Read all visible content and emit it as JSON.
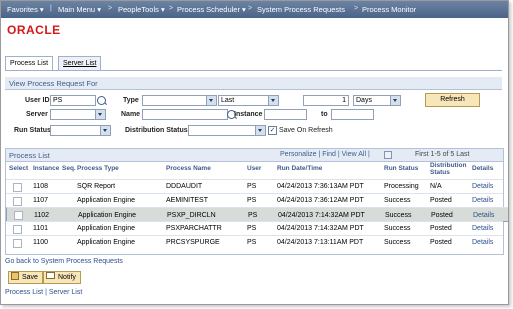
{
  "topnav": {
    "items": [
      {
        "label": "Favorites"
      },
      {
        "label": "Main Menu"
      },
      {
        "label": "PeopleTools"
      },
      {
        "label": "Process Scheduler"
      },
      {
        "label": "System Process Requests"
      },
      {
        "label": "Process Monitor"
      }
    ]
  },
  "logo": "ORACLE",
  "tabs": [
    {
      "label": "Process List",
      "active": true
    },
    {
      "label": "Server List",
      "active": false
    }
  ],
  "filters": {
    "section_title": "View Process Request For",
    "user_id_label": "User ID",
    "user_id_value": "PS",
    "type_label": "Type",
    "type_value": "",
    "last_value": "Last",
    "last_count": "1",
    "days_value": "Days",
    "refresh_label": "Refresh",
    "server_label": "Server",
    "server_value": "",
    "name_label": "Name",
    "name_value": "",
    "instance_label": "Instance",
    "instance_from": "",
    "to_label": "to",
    "instance_to": "",
    "run_status_label": "Run Status",
    "run_status_value": "",
    "dist_status_label": "Distribution Status",
    "dist_status_value": "",
    "save_on_refresh_label": "Save On Refresh"
  },
  "process_list": {
    "title": "Process List",
    "links": "Personalize | Find | View All |",
    "pager": "First  1-5 of 5  Last",
    "columns": [
      "Select",
      "Instance",
      "Seq.",
      "Process Type",
      "Process Name",
      "User",
      "Run Date/Time",
      "Run Status",
      "Distribution Status",
      "Details"
    ],
    "rows": [
      {
        "instance": "1108",
        "seq": "",
        "type": "SQR Report",
        "name": "DDDAUDIT",
        "user": "PS",
        "datetime": "04/24/2013  7:36:13AM PDT",
        "status": "Processing",
        "dist": "N/A",
        "details": "Details",
        "selected": false
      },
      {
        "instance": "1107",
        "seq": "",
        "type": "Application Engine",
        "name": "AEMINITEST",
        "user": "PS",
        "datetime": "04/24/2013  7:36:12AM PDT",
        "status": "Success",
        "dist": "Posted",
        "details": "Details",
        "selected": false
      },
      {
        "instance": "1102",
        "seq": "",
        "type": "Application Engine",
        "name": "PSXP_DIRCLN",
        "user": "PS",
        "datetime": "04/24/2013  7:14:32AM PDT",
        "status": "Success",
        "dist": "Posted",
        "details": "Details",
        "selected": true
      },
      {
        "instance": "1101",
        "seq": "",
        "type": "Application Engine",
        "name": "PSXPARCHATTR",
        "user": "PS",
        "datetime": "04/24/2013  7:14:32AM PDT",
        "status": "Success",
        "dist": "Posted",
        "details": "Details",
        "selected": false
      },
      {
        "instance": "1100",
        "seq": "",
        "type": "Application Engine",
        "name": "PRCSYSPURGE",
        "user": "PS",
        "datetime": "04/24/2013  7:13:11AM PDT",
        "status": "Success",
        "dist": "Posted",
        "details": "Details",
        "selected": false
      }
    ]
  },
  "footer": {
    "back_link": "Go back to System Process Requests",
    "save_label": "Save",
    "notify_label": "Notify",
    "bottom_links": "Process List | Server List"
  }
}
